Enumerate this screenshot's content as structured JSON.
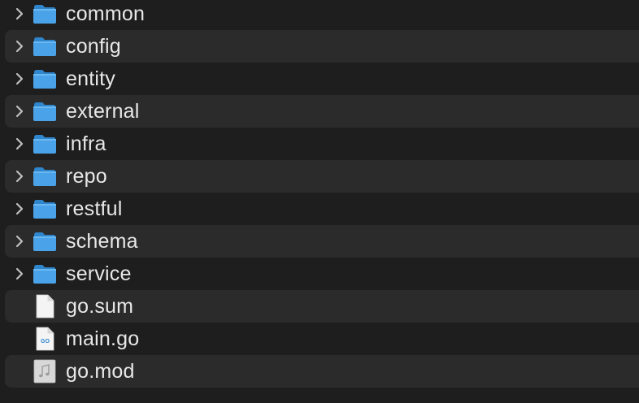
{
  "items": [
    {
      "label": "common",
      "type": "folder",
      "icon": "folder-icon"
    },
    {
      "label": "config",
      "type": "folder",
      "icon": "folder-icon"
    },
    {
      "label": "entity",
      "type": "folder",
      "icon": "folder-icon"
    },
    {
      "label": "external",
      "type": "folder",
      "icon": "folder-icon"
    },
    {
      "label": "infra",
      "type": "folder",
      "icon": "folder-icon"
    },
    {
      "label": "repo",
      "type": "folder",
      "icon": "folder-icon"
    },
    {
      "label": "restful",
      "type": "folder",
      "icon": "folder-icon"
    },
    {
      "label": "schema",
      "type": "folder",
      "icon": "folder-icon"
    },
    {
      "label": "service",
      "type": "folder",
      "icon": "folder-icon"
    },
    {
      "label": "go.sum",
      "type": "file",
      "icon": "blank-file-icon"
    },
    {
      "label": "main.go",
      "type": "go-file",
      "icon": "go-file-icon",
      "badge": "GO"
    },
    {
      "label": "go.mod",
      "type": "mod-file",
      "icon": "audio-file-icon"
    }
  ],
  "colors": {
    "folder": "#4aa3e8",
    "folder_tab": "#2f86cc",
    "row_alt": "#2b2b2b",
    "background": "#1e1e1e",
    "text": "#e8e8e8",
    "chevron": "#bfbfbf"
  }
}
